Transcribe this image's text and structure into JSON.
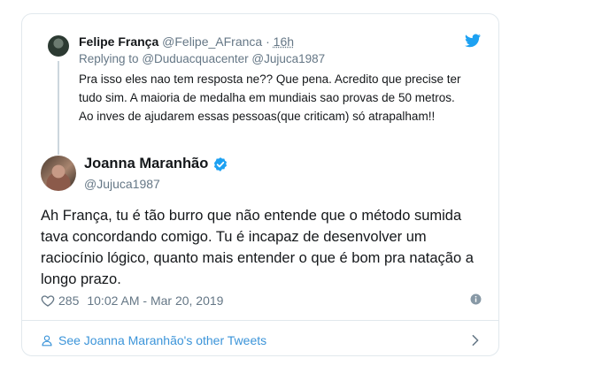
{
  "reply": {
    "name": "Felipe França",
    "handle": "@Felipe_AFranca",
    "separator": "·",
    "time": "16h",
    "replying_prefix": "Replying to",
    "mention_1": "@Duduacquacenter",
    "mention_2": "@Jujuca1987",
    "text": "Pra isso eles nao tem resposta ne?? Que pena. Acredito que precise ter tudo sim. A maioria de medalha em mundiais sao provas de 50 metros. Ao inves de ajudarem essas pessoas(que criticam) só atrapalham!!"
  },
  "tweet": {
    "name": "Joanna Maranhão",
    "handle": "@Jujuca1987",
    "text": "Ah França, tu é tão burro que não entende que o método sumida tava concordando comigo. Tu é incapaz de desenvolver um raciocínio lógico, quanto mais entender o que é bom pra natação a longo prazo.",
    "likes": "285",
    "timestamp": "10:02 AM - Mar 20, 2019"
  },
  "footer": {
    "link_label": "See Joanna Maranhão's other Tweets"
  },
  "colors": {
    "twitter_blue": "#1da1f2",
    "link_blue": "#3b94d9",
    "muted_gray": "#657786",
    "border": "#e1e8ed"
  },
  "icons": [
    "twitter-bird-icon",
    "verified-badge-icon",
    "heart-icon",
    "info-icon",
    "person-icon",
    "chevron-right-icon"
  ]
}
